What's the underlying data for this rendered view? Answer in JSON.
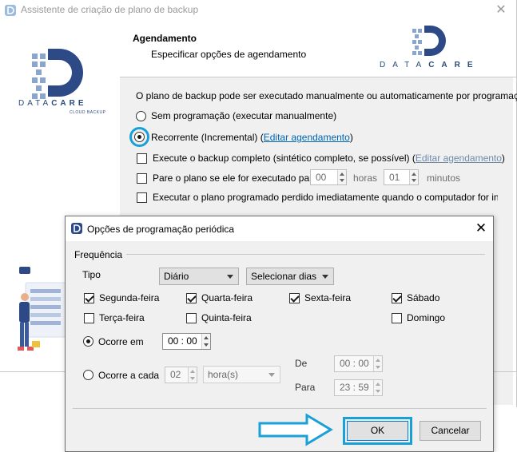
{
  "wizard": {
    "title": "Assistente de criação de plano de backup",
    "header_title": "Agendamento",
    "header_subtitle": "Especificar opções de agendamento",
    "intro": "O plano de backup pode ser executado manualmente ou automaticamente por programação.",
    "radio_manual": "Sem programação (executar manualmente)",
    "radio_recurring": "Recorrente (Incremental)",
    "edit_schedule_link": "Editar agendamento",
    "full_backup_label": "Execute o backup completo (sintético completo, se possível)",
    "full_backup_link": "Editar agendamento",
    "stop_plan_label": "Pare o plano se ele for executado para:",
    "stop_hours_value": "00",
    "stop_hours_unit": "horas",
    "stop_minutes_value": "01",
    "stop_minutes_unit": "minutos",
    "missed_label": "Executar o plano programado perdido imediatamente quando o computador for inicializa",
    "logo_text_left": "DATA",
    "logo_text_right": "CARE",
    "logo_sub": "CLOUD BACKUP",
    "paren_open": "(",
    "paren_close": ")"
  },
  "dialog": {
    "title": "Opções de programação periódica",
    "frequency_label": "Frequência",
    "type_label": "Tipo",
    "type_value": "Diário",
    "days_select": "Selecionar dias",
    "days": [
      {
        "label": "Segunda-feira",
        "checked": true
      },
      {
        "label": "Quarta-feira",
        "checked": true
      },
      {
        "label": "Sexta-feira",
        "checked": true
      },
      {
        "label": "Sábado",
        "checked": true
      },
      {
        "label": "Terça-feira",
        "checked": false
      },
      {
        "label": "Quinta-feira",
        "checked": false
      },
      {
        "label": "Domingo",
        "checked": false
      }
    ],
    "occurs_at_label": "Ocorre em",
    "occurs_at_value": "00 : 00",
    "occurs_every_label": "Ocorre a cada",
    "every_value": "02",
    "every_unit": "hora(s)",
    "from_label": "De",
    "from_value": "00 : 00",
    "to_label": "Para",
    "to_value": "23 : 59",
    "ok_label": "OK",
    "cancel_label": "Cancelar"
  },
  "colors": {
    "highlight": "#1aa0d8",
    "link": "#0063b1",
    "logo": "#2a4a7a"
  }
}
